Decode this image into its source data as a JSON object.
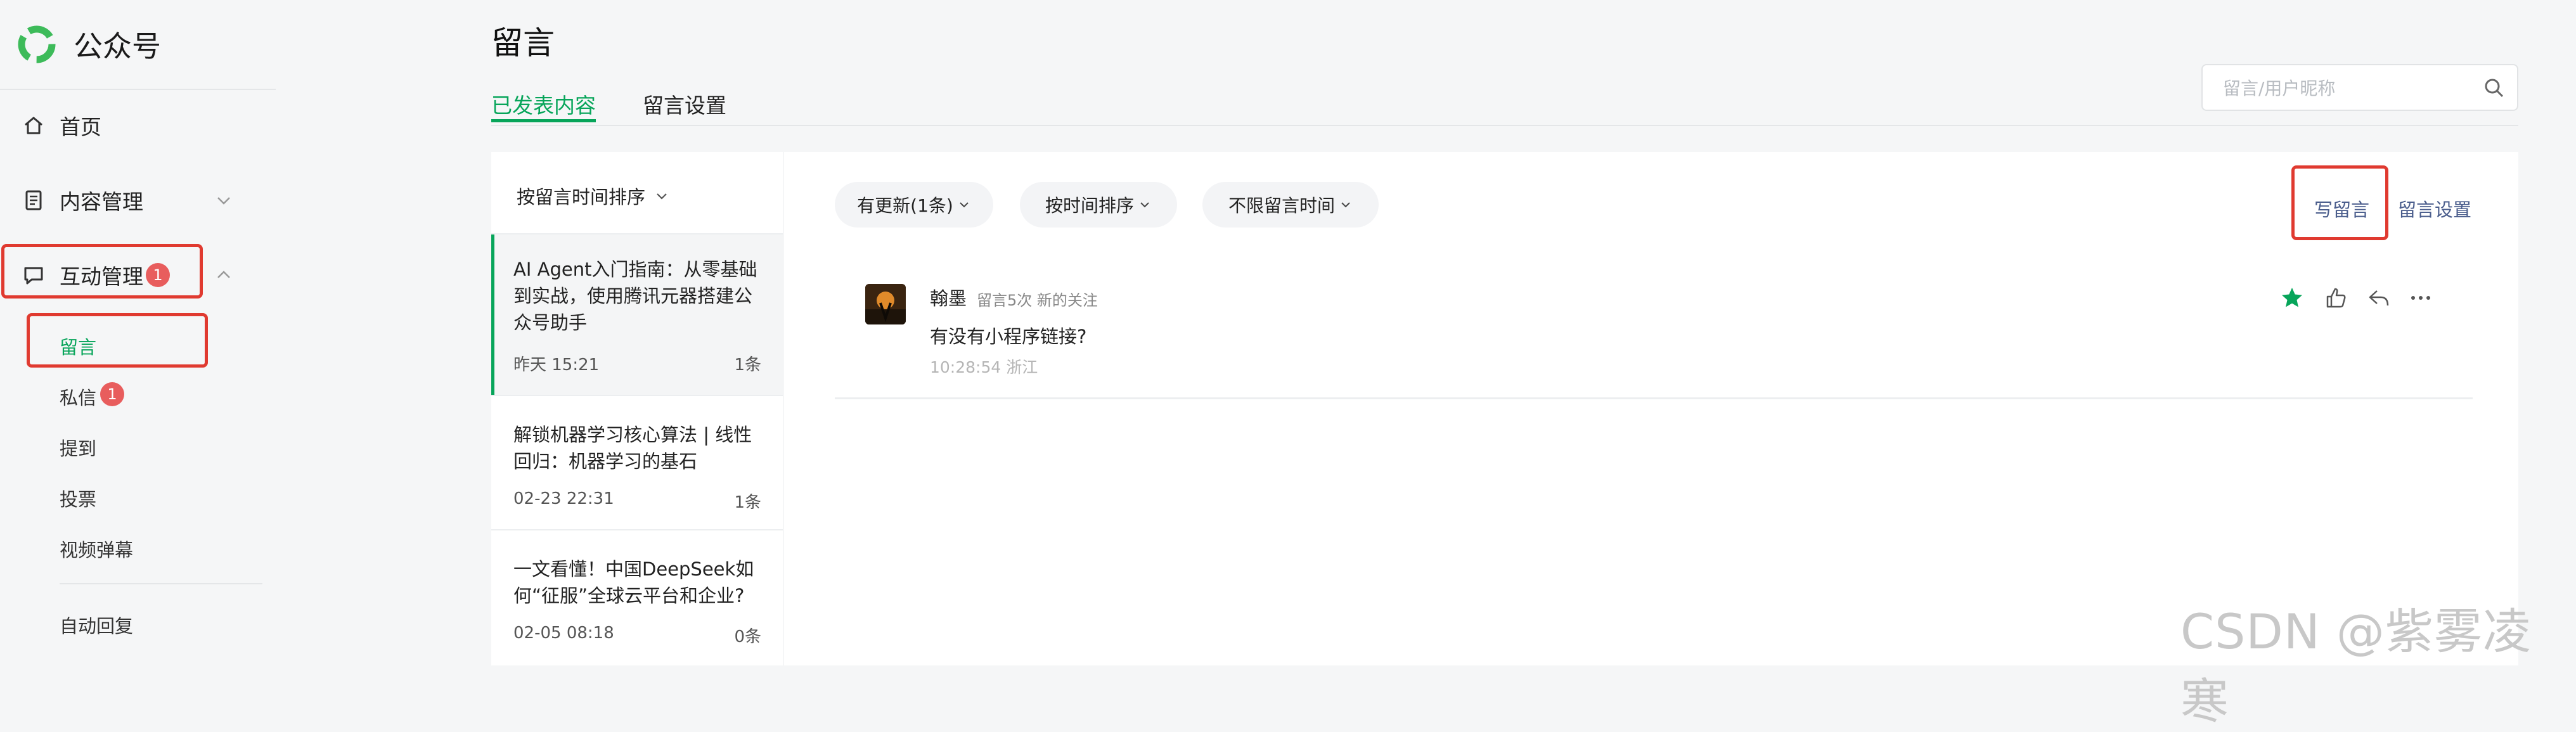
{
  "sidebar": {
    "brand": "公众号",
    "nav": {
      "home": "首页",
      "content": "内容管理",
      "interaction": "互动管理",
      "interaction_badge": "1"
    },
    "sub_items": {
      "comments": "留言",
      "messages": "私信",
      "messages_badge": "1",
      "mentions": "提到",
      "votes": "投票",
      "video_danmaku": "视频弹幕",
      "auto_reply": "自动回复"
    }
  },
  "header": {
    "title": "留言",
    "tabs": [
      "已发表内容",
      "留言设置"
    ],
    "search_placeholder": "留言/用户昵称"
  },
  "article_list": {
    "sort_label": "按留言时间排序",
    "items": [
      {
        "title": "AI Agent入门指南：从零基础到实战，使用腾讯元器搭建公众号助手",
        "time": "昨天 15:21",
        "count": "1条"
      },
      {
        "title": "解锁机器学习核心算法 | 线性回归：机器学习的基石",
        "time": "02-23 22:31",
        "count": "1条"
      },
      {
        "title": "一文看懂！中国DeepSeek如何“征服”全球云平台和企业?",
        "time": "02-05 08:18",
        "count": "0条"
      }
    ]
  },
  "comments_panel": {
    "filters": [
      "有更新(1条)",
      "按时间排序",
      "不限留言时间"
    ],
    "write_comment": "写留言",
    "comment_settings": "留言设置",
    "comment": {
      "user": "翰墨",
      "meta": "留言5次  新的关注",
      "text": "有没有小程序链接?",
      "time": "10:28:54 浙江"
    }
  },
  "watermark": "CSDN @紫雾凌寒",
  "colors": {
    "accent": "#07a55a",
    "highlight_box": "#e03a30",
    "badge": "#e85d5d",
    "link": "#4a5d8c"
  }
}
